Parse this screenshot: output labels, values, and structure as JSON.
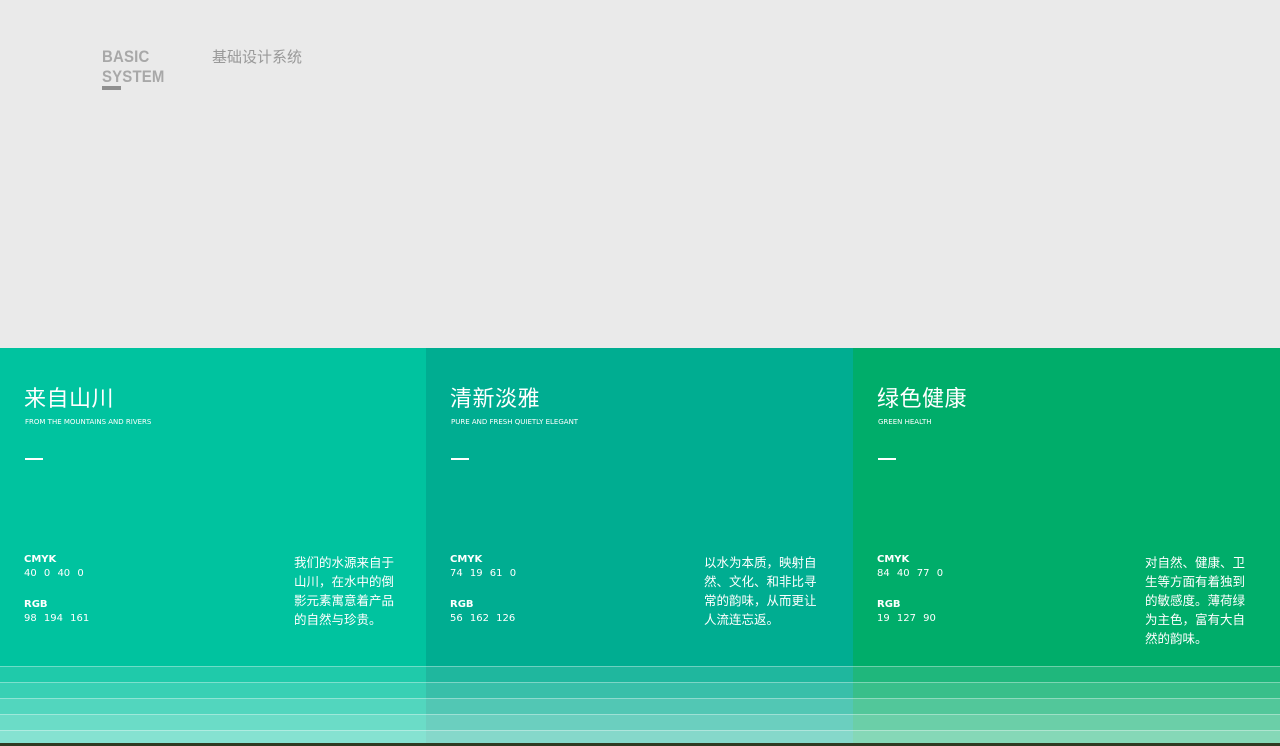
{
  "header": {
    "brand_en": "BASIC SYSTEM",
    "brand_cn": "基础设计系统"
  },
  "panels": [
    {
      "title": "来自山川",
      "subtitle": "FROM THE MOUNTAINS AND RIVERS",
      "cmyk_label": "CMYK",
      "cmyk_value": "40 0 40 0",
      "rgb_label": "RGB",
      "rgb_value": "98 194 161",
      "description": "我们的水源来自于山川，在水中的倒影元素寓意着产品的自然与珍贵。",
      "color": "#00c39f"
    },
    {
      "title": "清新淡雅",
      "subtitle": "PURE AND FRESH QUIETLY ELEGANT",
      "cmyk_label": "CMYK",
      "cmyk_value": "74 19 61 0",
      "rgb_label": "RGB",
      "rgb_value": "56 162 126",
      "description": "以水为本质，映射自然、文化、和非比寻常的韵味，从而更让人流连忘返。",
      "color": "#00ad91"
    },
    {
      "title": "绿色健康",
      "subtitle": "GREEN HEALTH",
      "cmyk_label": "CMYK",
      "cmyk_value": "84 40 77 0",
      "rgb_label": "RGB",
      "rgb_value": "19 127 90",
      "description": "对自然、健康、卫生等方面有着独到的敏感度。薄荷绿为主色，富有大自然的韵味。",
      "color": "#00ad6a"
    }
  ],
  "tints": [
    "#19c9a8",
    "#33cfb1",
    "#4dd5bb",
    "#66dbc5",
    "#7fe0ce"
  ]
}
